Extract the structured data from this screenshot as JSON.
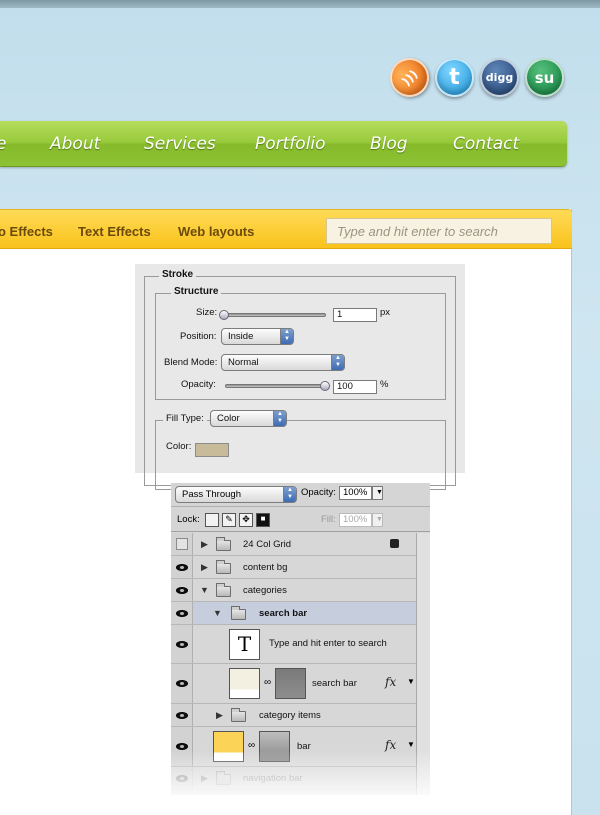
{
  "social": [
    {
      "name": "rss-icon",
      "glyph": ")))"
    },
    {
      "name": "twitter-icon",
      "glyph": "t"
    },
    {
      "name": "digg-icon",
      "glyph": "digg"
    },
    {
      "name": "stumbleupon-icon",
      "glyph": "su"
    }
  ],
  "nav": {
    "items": [
      {
        "label": "e"
      },
      {
        "label": "About"
      },
      {
        "label": "Services"
      },
      {
        "label": "Portfolio"
      },
      {
        "label": "Blog"
      },
      {
        "label": "Contact"
      }
    ]
  },
  "categories": {
    "items": [
      {
        "label": "o Effects"
      },
      {
        "label": "Text Effects"
      },
      {
        "label": "Web layouts"
      }
    ],
    "search_placeholder": "Type and hit enter to search"
  },
  "stroke_panel": {
    "title": "Stroke",
    "structure_title": "Structure",
    "size_label": "Size:",
    "size_value": "1",
    "size_unit": "px",
    "position_label": "Position:",
    "position_value": "Inside",
    "blend_label": "Blend Mode:",
    "blend_value": "Normal",
    "opacity_label": "Opacity:",
    "opacity_value": "100",
    "opacity_unit": "%",
    "opacity_level": 1.0,
    "size_level": 0.0,
    "fill_type_label": "Fill Type:",
    "fill_type_value": "Color",
    "color_label": "Color:",
    "color_swatch": "#c8bb9a"
  },
  "layers_panel": {
    "blend_mode": "Pass Through",
    "opacity_label": "Opacity:",
    "opacity_value": "100%",
    "lock_label": "Lock:",
    "fill_label": "Fill:",
    "fill_value": "100%",
    "rows": [
      {
        "name": "24 Col Grid"
      },
      {
        "name": "content bg"
      },
      {
        "name": "categories"
      },
      {
        "name": "search bar"
      },
      {
        "name": "Type and hit enter to search",
        "thumb_glyph": "T"
      },
      {
        "name": "search bar"
      },
      {
        "name": "category items"
      },
      {
        "name": "bar"
      },
      {
        "name": "navigation bar"
      }
    ],
    "fx_glyph": "fx"
  },
  "colors": {
    "sky": "#c8e2ef",
    "nav_green": "#97c93a",
    "category_yellow": "#f9c21b",
    "search_thumb": "#f3efe1",
    "bar_thumb": "#fbd356"
  }
}
